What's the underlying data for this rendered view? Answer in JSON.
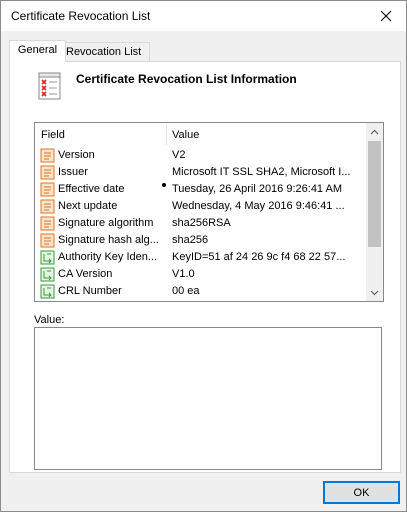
{
  "window": {
    "title": "Certificate Revocation List"
  },
  "tabs": [
    {
      "label": "General",
      "active": true
    },
    {
      "label": "Revocation List",
      "active": false
    }
  ],
  "general": {
    "heading": "Certificate Revocation List Information",
    "list_header": {
      "field": "Field",
      "value": "Value"
    },
    "rows": [
      {
        "icon": "field-icon",
        "field": "Version",
        "value": "V2"
      },
      {
        "icon": "field-icon",
        "field": "Issuer",
        "value": "Microsoft IT SSL SHA2, Microsoft I..."
      },
      {
        "icon": "field-icon",
        "field": "Effective date",
        "value": "Tuesday, 26 April 2016 9:26:41 AM"
      },
      {
        "icon": "field-icon",
        "field": "Next update",
        "value": "Wednesday, 4 May 2016 9:46:41 ..."
      },
      {
        "icon": "field-icon",
        "field": "Signature algorithm",
        "value": "sha256RSA"
      },
      {
        "icon": "field-icon",
        "field": "Signature hash alg...",
        "value": "sha256"
      },
      {
        "icon": "extension-icon",
        "field": "Authority Key Iden...",
        "value": "KeyID=51 af 24 26 9c f4 68 22 57..."
      },
      {
        "icon": "extension-icon",
        "field": "CA Version",
        "value": "V1.0"
      },
      {
        "icon": "extension-icon",
        "field": "CRL Number",
        "value": "00 ea"
      }
    ],
    "value_label": "Value:"
  },
  "buttons": {
    "ok": "OK"
  },
  "colors": {
    "accent": "#0078d7",
    "field_icon": "#d9772b",
    "extension_icon": "#3a9a3a"
  }
}
